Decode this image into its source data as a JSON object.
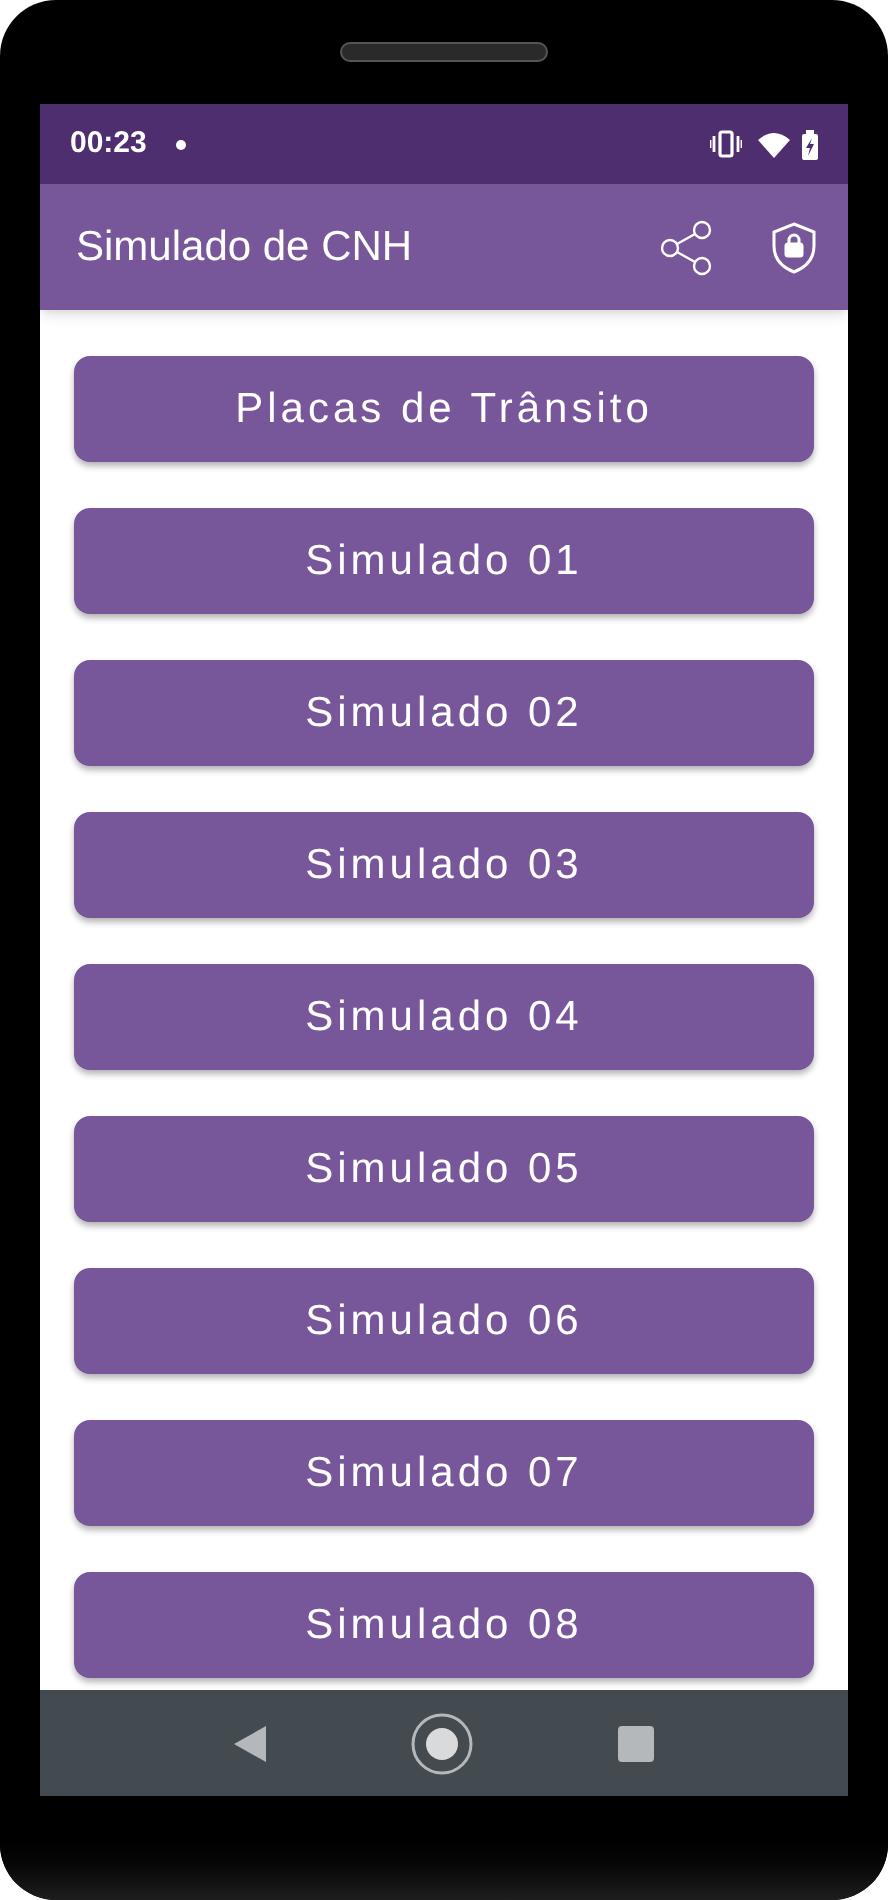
{
  "status_bar": {
    "time": "00:23"
  },
  "app_bar": {
    "title": "Simulado de CNH"
  },
  "buttons": [
    "Placas de Trânsito",
    "Simulado 01",
    "Simulado 02",
    "Simulado 03",
    "Simulado 04",
    "Simulado 05",
    "Simulado 06",
    "Simulado 07",
    "Simulado 08"
  ]
}
